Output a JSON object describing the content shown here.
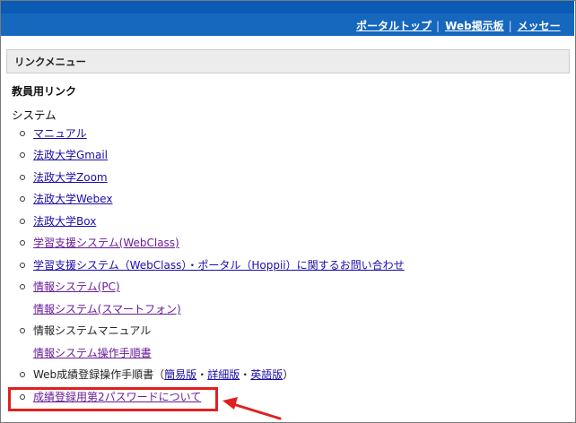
{
  "nav": {
    "links": [
      "ポータルトップ",
      "Web掲示板",
      "メッセー"
    ],
    "separator": "|"
  },
  "menu": {
    "header": "リンクメニュー",
    "section_title": "教員用リンク",
    "category": "システム",
    "items": [
      "マニュアル",
      "法政大学Gmail",
      "法政大学Zoom",
      "法政大学Webex",
      "法政大学Box",
      "学習支援システム(WebClass)",
      "学習支援システム（WebClass）・ポータル（Hoppii）に関するお問い合わせ",
      "情報システム(PC)",
      "情報システム(スマートフォン)",
      "情報システムマニュアル",
      "情報システム操作手順書"
    ],
    "web_grade": {
      "prefix": "Web成績登録操作手順書（",
      "link1": "簡易版",
      "dot1": "・",
      "link2": "詳細版",
      "dot2": "・",
      "link3": "英語版",
      "suffix": "）"
    },
    "last_item": "成績登録用第2パスワードについて"
  },
  "colors": {
    "nav_blue": "#1667be",
    "link": "#1a0dab",
    "visited": "#6a1b9a",
    "highlight": "#e02020"
  }
}
